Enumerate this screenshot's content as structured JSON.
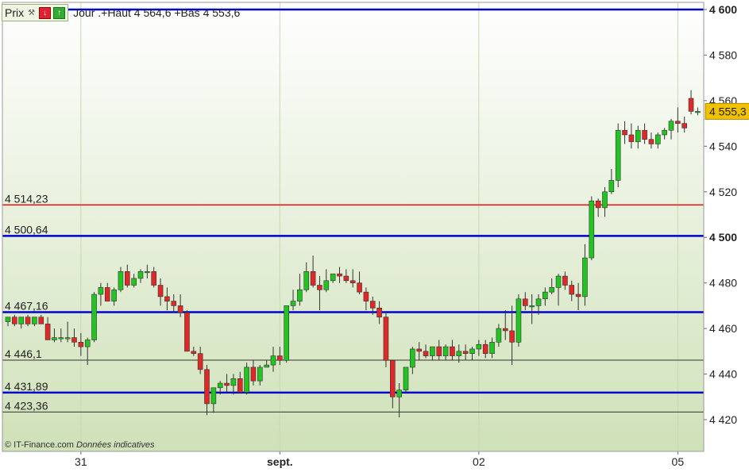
{
  "header": {
    "prix_label": "Prix",
    "subtitle": "Jour .+Haut 4 564,6 +Bas 4 553,6"
  },
  "credit": {
    "source": "© IT-Finance.com",
    "note": "Données indicatives"
  },
  "colors": {
    "up": "#22c422",
    "down": "#e02828",
    "blue_line": "#0000d0",
    "red_line": "#e02020",
    "thin_line": "#333333",
    "bg_top": "#ffffff",
    "bg_bottom": "#cfe1b8",
    "price_badge": "#f2c200"
  },
  "chart_data": {
    "type": "candlestick",
    "ylim": [
      4410,
      4602
    ],
    "y_ticks": [
      {
        "value": 4420,
        "label": "4 420",
        "bold": false
      },
      {
        "value": 4440,
        "label": "4 440",
        "bold": false
      },
      {
        "value": 4460,
        "label": "4 460",
        "bold": false
      },
      {
        "value": 4480,
        "label": "4 480",
        "bold": false
      },
      {
        "value": 4500,
        "label": "4 500",
        "bold": true
      },
      {
        "value": 4520,
        "label": "4 520",
        "bold": false
      },
      {
        "value": 4540,
        "label": "4 540",
        "bold": false
      },
      {
        "value": 4560,
        "label": "4 560",
        "bold": false
      },
      {
        "value": 4580,
        "label": "4 580",
        "bold": false
      },
      {
        "value": 4600,
        "label": "4 600",
        "bold": true
      }
    ],
    "x_ticks": [
      {
        "label": "31",
        "bold": false,
        "candle": 11
      },
      {
        "label": "sept.",
        "bold": true,
        "candle": 41
      },
      {
        "label": "02",
        "bold": false,
        "candle": 71
      },
      {
        "label": "05",
        "bold": false,
        "candle": 101
      }
    ],
    "last_price": {
      "value": 4555.3,
      "label": "4 555,3"
    },
    "levels": [
      {
        "value": 4600,
        "label": "",
        "color": "blue"
      },
      {
        "value": 4514.23,
        "label": "4 514,23",
        "color": "red"
      },
      {
        "value": 4500.64,
        "label": "4 500,64",
        "color": "blue"
      },
      {
        "value": 4467.16,
        "label": "4 467,16",
        "color": "blue"
      },
      {
        "value": 4446.1,
        "label": "4 446,1",
        "color": "thin"
      },
      {
        "value": 4431.89,
        "label": "4 431,89",
        "color": "blue"
      },
      {
        "value": 4423.36,
        "label": "4 423,36",
        "color": "thin"
      }
    ],
    "candles": [
      [
        4463,
        4465,
        4461,
        4465
      ],
      [
        4465,
        4466,
        4461,
        4462
      ],
      [
        4462,
        4465,
        4460,
        4465
      ],
      [
        4465,
        4466,
        4461,
        4462
      ],
      [
        4462,
        4465,
        4461,
        4465
      ],
      [
        4465,
        4466,
        4462,
        4462
      ],
      [
        4462,
        4465,
        4455,
        4455
      ],
      [
        4455,
        4460,
        4454,
        4456
      ],
      [
        4456,
        4460,
        4454,
        4456
      ],
      [
        4456,
        4463,
        4454,
        4456
      ],
      [
        4456,
        4460,
        4452,
        4454
      ],
      [
        4454,
        4458,
        4448,
        4452
      ],
      [
        4452,
        4456,
        4444,
        4455
      ],
      [
        4455,
        4476,
        4454,
        4475
      ],
      [
        4475,
        4480,
        4470,
        4478
      ],
      [
        4478,
        4480,
        4472,
        4472
      ],
      [
        4472,
        4478,
        4470,
        4477
      ],
      [
        4477,
        4487,
        4476,
        4485
      ],
      [
        4485,
        4488,
        4478,
        4479
      ],
      [
        4479,
        4484,
        4478,
        4482
      ],
      [
        4482,
        4486,
        4480,
        4485
      ],
      [
        4485,
        4488,
        4482,
        4485
      ],
      [
        4485,
        4487,
        4478,
        4479
      ],
      [
        4479,
        4482,
        4470,
        4474
      ],
      [
        4474,
        4478,
        4468,
        4472
      ],
      [
        4472,
        4475,
        4467,
        4470
      ],
      [
        4470,
        4475,
        4465,
        4467
      ],
      [
        4467,
        4468,
        4450,
        4450
      ],
      [
        4450,
        4452,
        4448,
        4449
      ],
      [
        4449,
        4452,
        4440,
        4442
      ],
      [
        4442,
        4444,
        4422,
        4427
      ],
      [
        4427,
        4434,
        4423,
        4434
      ],
      [
        4434,
        4437,
        4431,
        4436
      ],
      [
        4436,
        4440,
        4432,
        4435
      ],
      [
        4435,
        4440,
        4431,
        4438
      ],
      [
        4438,
        4441,
        4432,
        4432
      ],
      [
        4432,
        4445,
        4431,
        4443
      ],
      [
        4443,
        4446,
        4435,
        4437
      ],
      [
        4437,
        4444,
        4435,
        4443
      ],
      [
        4443,
        4446,
        4444,
        4444
      ],
      [
        4444,
        4452,
        4441,
        4448
      ],
      [
        4448,
        4452,
        4444,
        4446
      ],
      [
        4446,
        4470,
        4445,
        4470
      ],
      [
        4470,
        4477,
        4468,
        4472
      ],
      [
        4472,
        4484,
        4470,
        4477
      ],
      [
        4477,
        4489,
        4476,
        4485
      ],
      [
        4485,
        4492,
        4478,
        4479
      ],
      [
        4479,
        4483,
        4468,
        4477
      ],
      [
        4477,
        4486,
        4476,
        4481
      ],
      [
        4481,
        4484,
        4480,
        4484
      ],
      [
        4484,
        4487,
        4480,
        4483
      ],
      [
        4483,
        4486,
        4480,
        4481
      ],
      [
        4481,
        4486,
        4478,
        4480
      ],
      [
        4480,
        4485,
        4475,
        4476
      ],
      [
        4476,
        4478,
        4468,
        4472
      ],
      [
        4472,
        4474,
        4466,
        4469
      ],
      [
        4469,
        4472,
        4462,
        4465
      ],
      [
        4465,
        4467,
        4443,
        4446
      ],
      [
        4446,
        4446,
        4425,
        4430
      ],
      [
        4430,
        4436,
        4421,
        4433
      ],
      [
        4433,
        4443,
        4432,
        4443
      ],
      [
        4443,
        4452,
        4440,
        4451
      ],
      [
        4451,
        4454,
        4446,
        4450
      ],
      [
        4450,
        4453,
        4447,
        4448
      ],
      [
        4448,
        4452,
        4446,
        4452
      ],
      [
        4452,
        4455,
        4446,
        4448
      ],
      [
        4448,
        4453,
        4446,
        4452
      ],
      [
        4452,
        4455,
        4446,
        4448
      ],
      [
        4448,
        4453,
        4445,
        4450
      ],
      [
        4450,
        4453,
        4446,
        4449
      ],
      [
        4449,
        4452,
        4446,
        4451
      ],
      [
        4451,
        4455,
        4448,
        4453
      ],
      [
        4453,
        4455,
        4447,
        4449
      ],
      [
        4449,
        4456,
        4447,
        4454
      ],
      [
        4454,
        4462,
        4452,
        4460
      ],
      [
        4460,
        4468,
        4455,
        4459
      ],
      [
        4459,
        4470,
        4444,
        4454
      ],
      [
        4454,
        4475,
        4452,
        4473
      ],
      [
        4473,
        4476,
        4468,
        4470
      ],
      [
        4470,
        4475,
        4462,
        4470
      ],
      [
        4470,
        4475,
        4466,
        4473
      ],
      [
        4473,
        4478,
        4470,
        4476
      ],
      [
        4476,
        4482,
        4475,
        4478
      ],
      [
        4478,
        4484,
        4470,
        4483
      ],
      [
        4483,
        4485,
        4477,
        4479
      ],
      [
        4479,
        4481,
        4472,
        4475
      ],
      [
        4475,
        4480,
        4468,
        4474
      ],
      [
        4474,
        4497,
        4470,
        4491
      ],
      [
        4491,
        4518,
        4490,
        4516
      ],
      [
        4516,
        4517,
        4509,
        4513
      ],
      [
        4513,
        4522,
        4509,
        4520
      ],
      [
        4520,
        4530,
        4519,
        4525
      ],
      [
        4525,
        4550,
        4522,
        4547
      ],
      [
        4547,
        4551,
        4541,
        4545
      ],
      [
        4545,
        4550,
        4539,
        4542
      ],
      [
        4542,
        4549,
        4539,
        4547
      ],
      [
        4547,
        4550,
        4541,
        4543
      ],
      [
        4543,
        4546,
        4539,
        4541
      ],
      [
        4541,
        4546,
        4539,
        4545
      ],
      [
        4545,
        4548,
        4543,
        4547
      ],
      [
        4547,
        4552,
        4543,
        4551
      ],
      [
        4551,
        4557,
        4546,
        4550
      ],
      [
        4550,
        4553,
        4546,
        4548
      ],
      [
        4561,
        4564.6,
        4554,
        4555.3
      ],
      [
        4555.3,
        4557,
        4553.6,
        4555.3
      ]
    ]
  }
}
